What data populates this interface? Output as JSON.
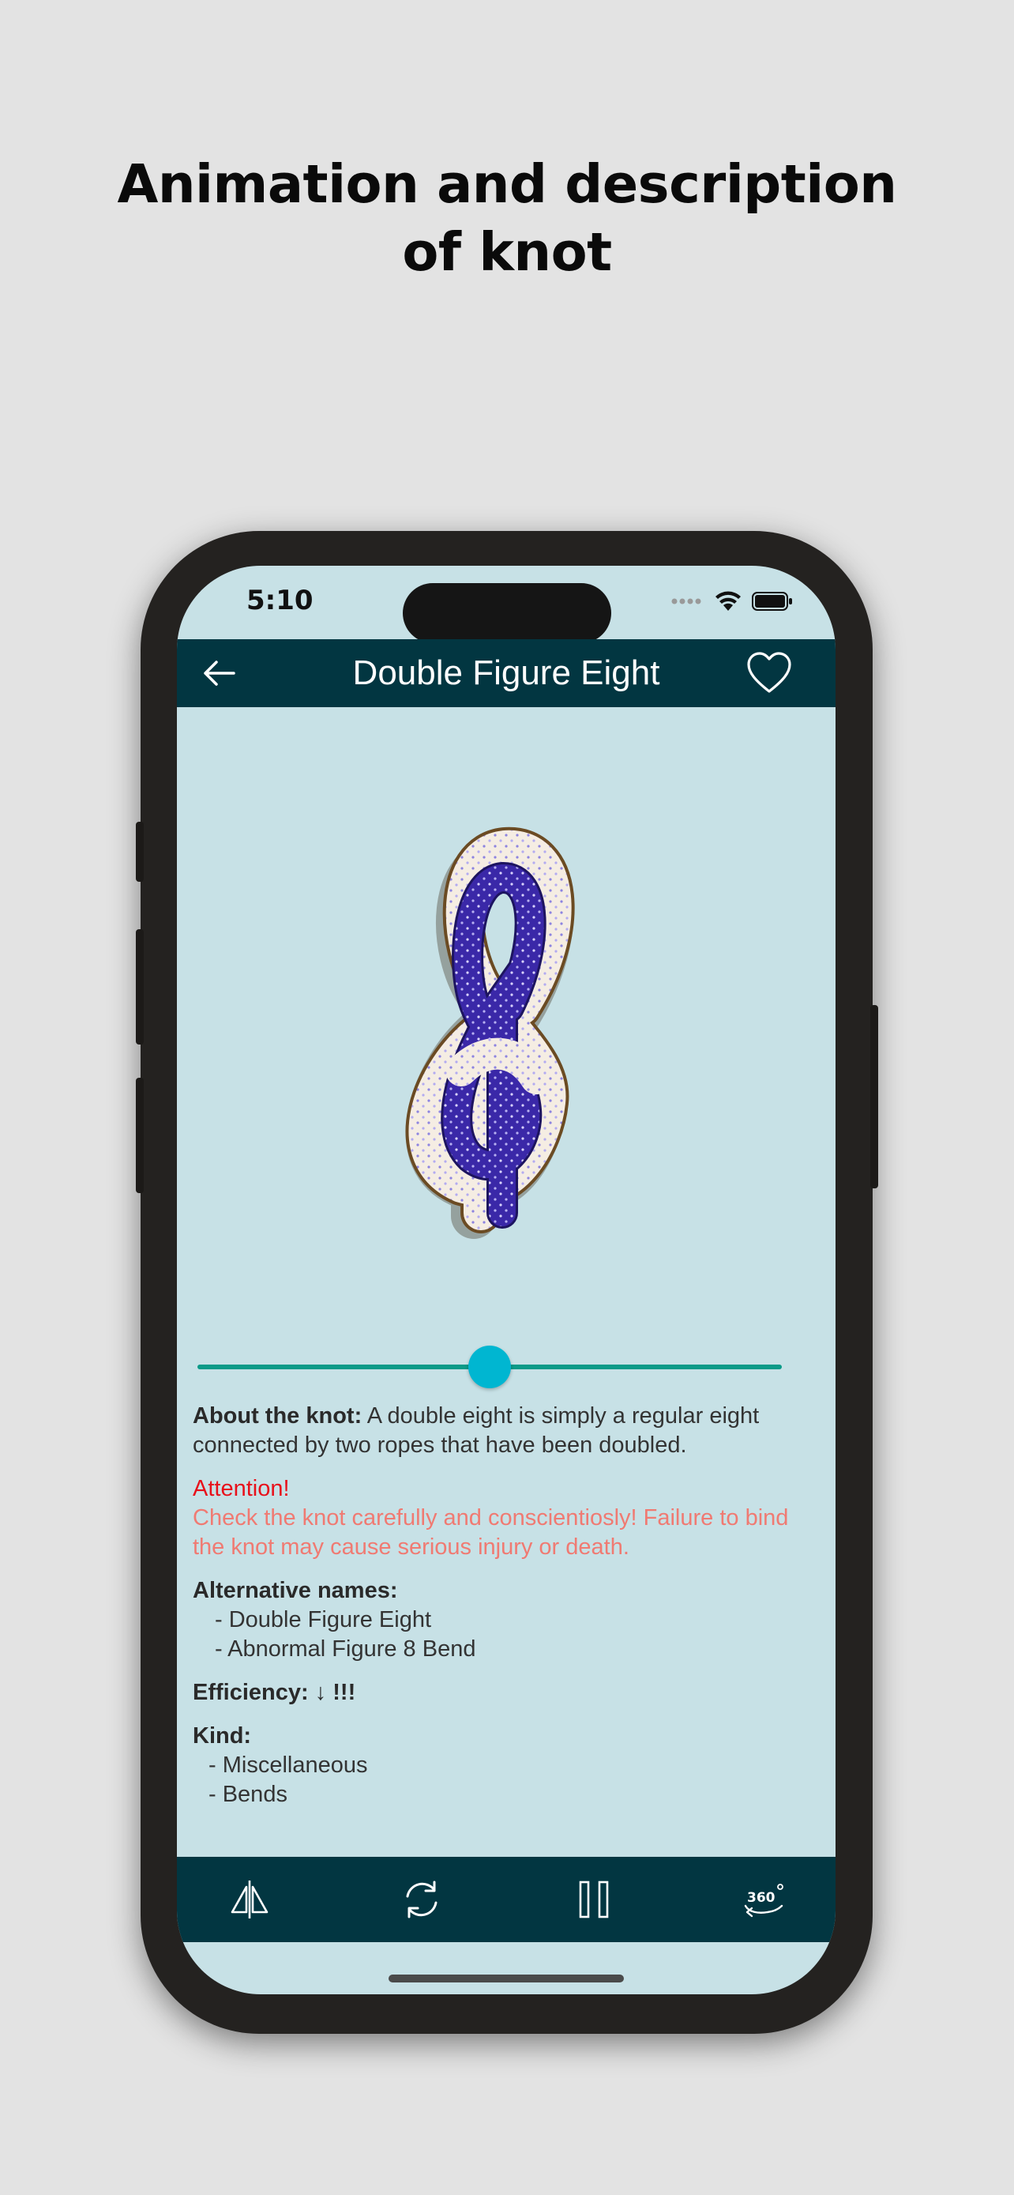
{
  "headline": {
    "line1": "Animation and description",
    "line2": "of knot"
  },
  "status_bar": {
    "time": "5:10"
  },
  "app_bar": {
    "title": "Double Figure Eight",
    "back_icon": "arrow-left-icon",
    "favorite_icon": "heart-outline-icon"
  },
  "slider": {
    "value": 0.5
  },
  "about": {
    "label": "About the knot:",
    "text": " A double eight is simply a regular eight connected by two ropes that have been doubled."
  },
  "attention": {
    "title": "Attention!",
    "text": "Check the knot carefully and conscientiosly! Failure to bind the knot may cause serious injury or death."
  },
  "alternative_names": {
    "label": "Alternative names:",
    "items": [
      "- Double Figure Eight",
      "- Abnormal Figure 8 Bend"
    ]
  },
  "efficiency": {
    "label": "Efficiency: ↓ !!!"
  },
  "kind": {
    "label": "Kind:",
    "items": [
      "- Miscellaneous",
      "- Bends"
    ]
  },
  "bottom_bar": {
    "icons": [
      "mirror-flip-icon",
      "rotate-icon",
      "pause-icon",
      "view-360-icon"
    ],
    "view360_text": "360"
  },
  "colors": {
    "app_bar": "#023641",
    "screen_bg": "#c7e1e6",
    "slider_track": "#0a9a88",
    "slider_thumb": "#00b6d1",
    "attention_title": "#e8101a",
    "attention_text": "#f07a72",
    "rope_blue": "#3a28a8",
    "rope_white": "#f5ede3"
  }
}
